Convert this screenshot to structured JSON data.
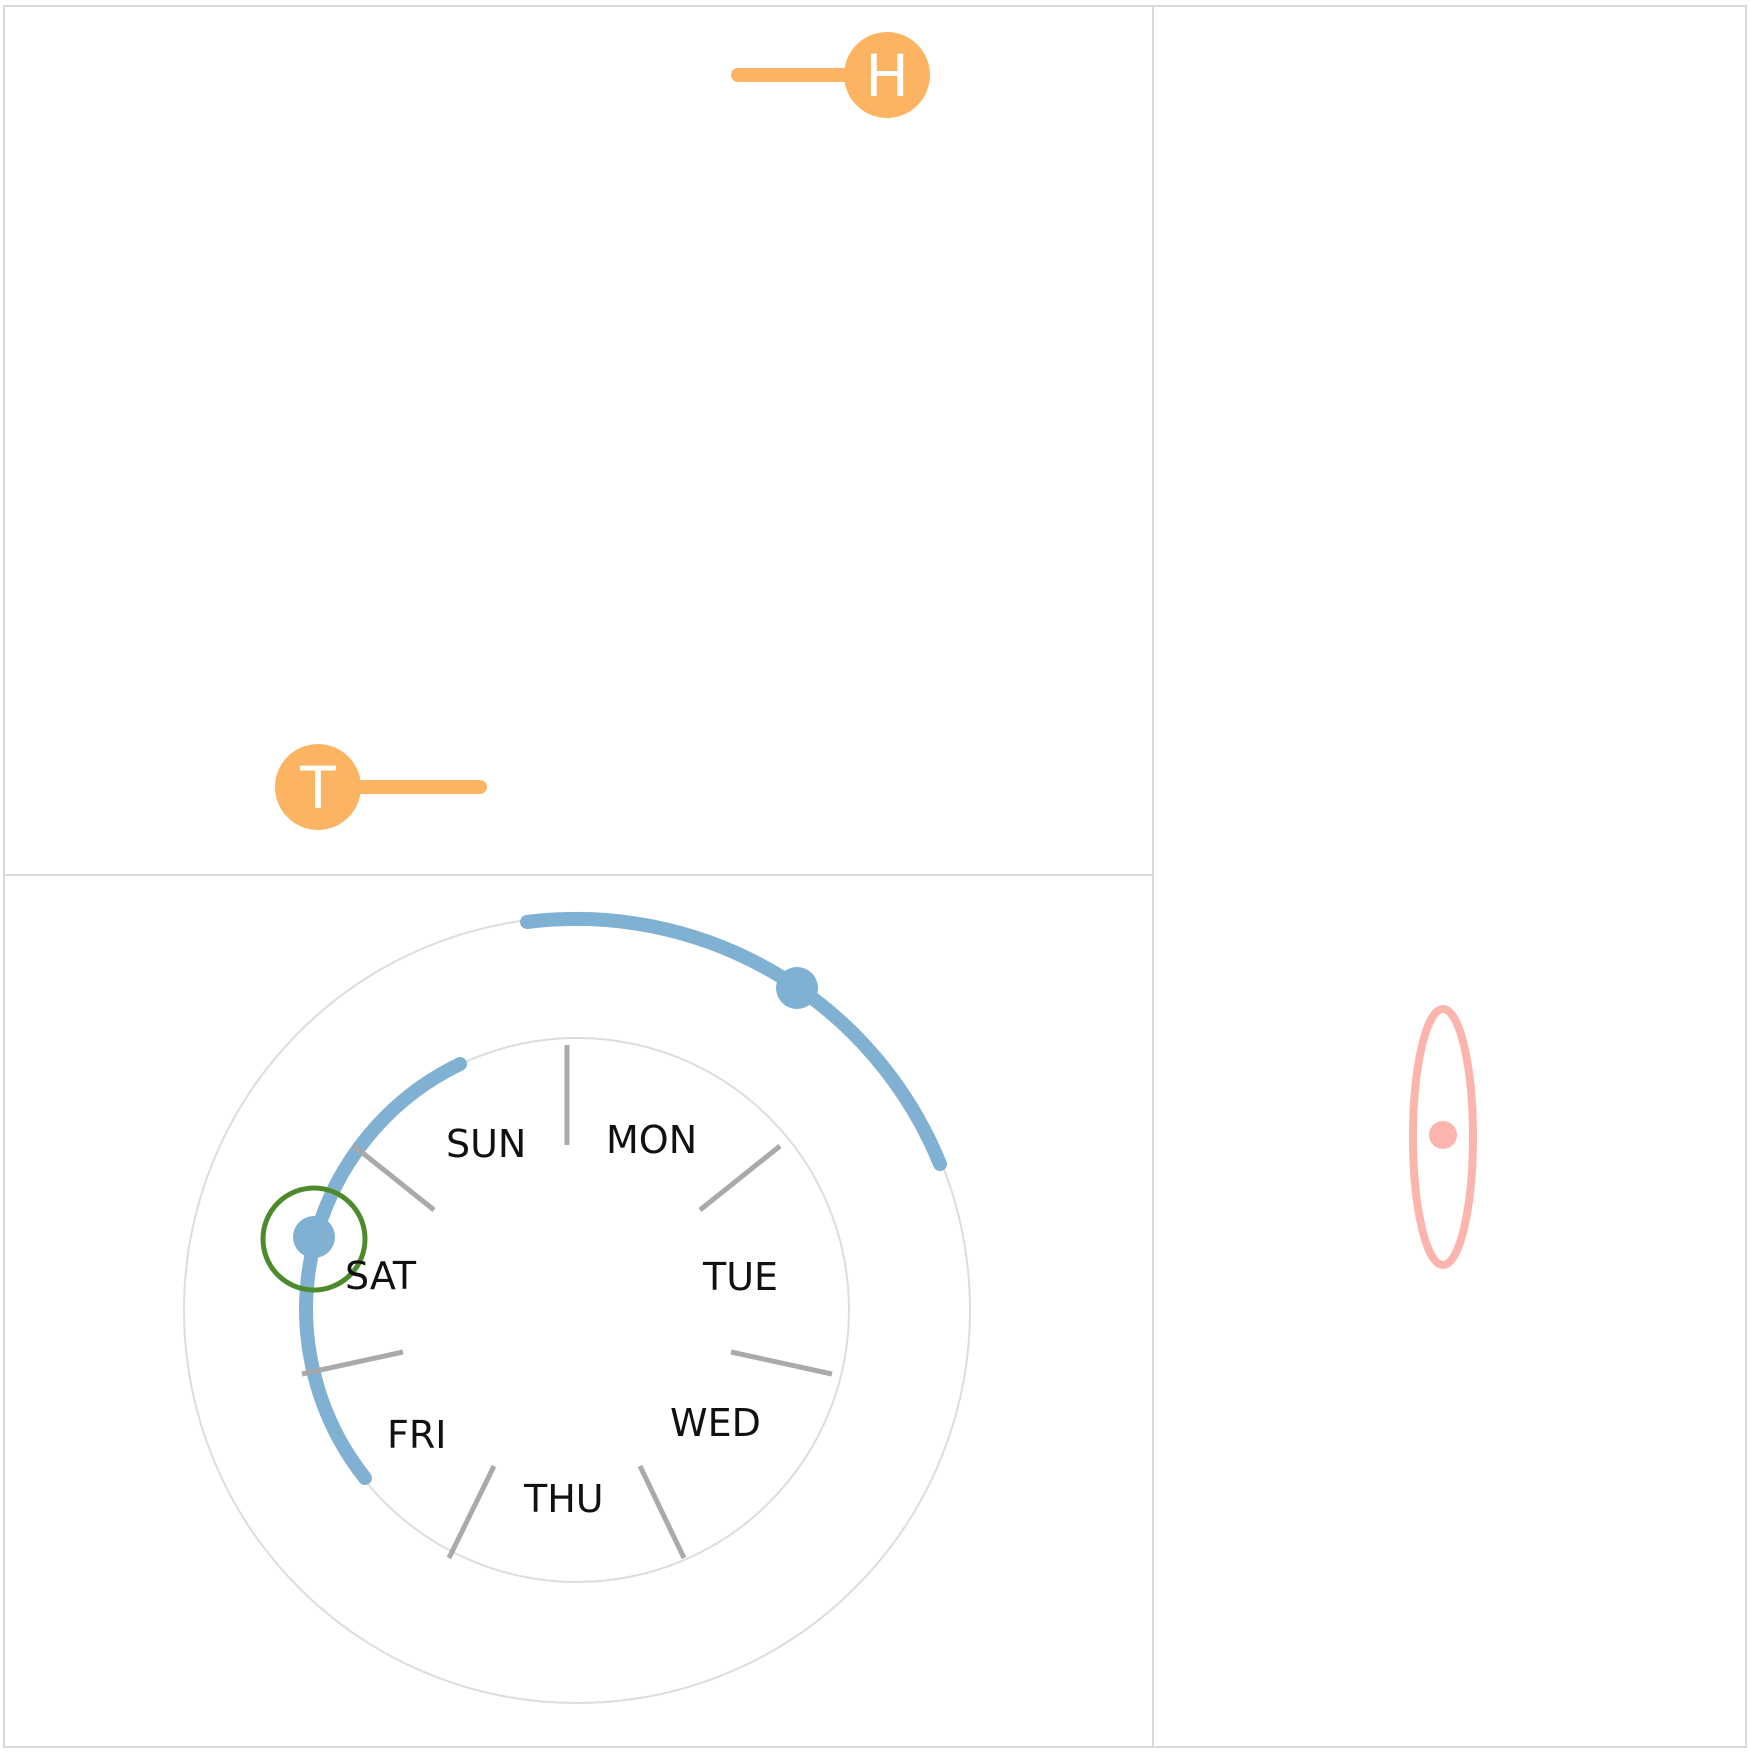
{
  "colors": {
    "panel_border": "#d9d9d9",
    "accent_orange": "#fdb462",
    "accent_blue": "#80b1d3",
    "accent_pink": "#fbb4ae",
    "accent_green": "#4d8a2c",
    "tick": "#a6a6a6",
    "ring_outline": "#dddddd",
    "label_text": "#111111"
  },
  "panels": [
    {
      "name": "top-left-panel"
    },
    {
      "name": "bottom-left-panel"
    },
    {
      "name": "right-panel"
    }
  ],
  "range_slider": {
    "start_handle": {
      "letter": "T",
      "icon": "slider-handle-icon"
    },
    "end_handle": {
      "letter": "H",
      "icon": "slider-handle-icon"
    }
  },
  "weekday_dial": {
    "days": [
      "SUN",
      "MON",
      "TUE",
      "WED",
      "THU",
      "FRI",
      "SAT"
    ],
    "selected_day": "SAT"
  },
  "oval_control": {
    "icon": "oval-slider-icon"
  }
}
